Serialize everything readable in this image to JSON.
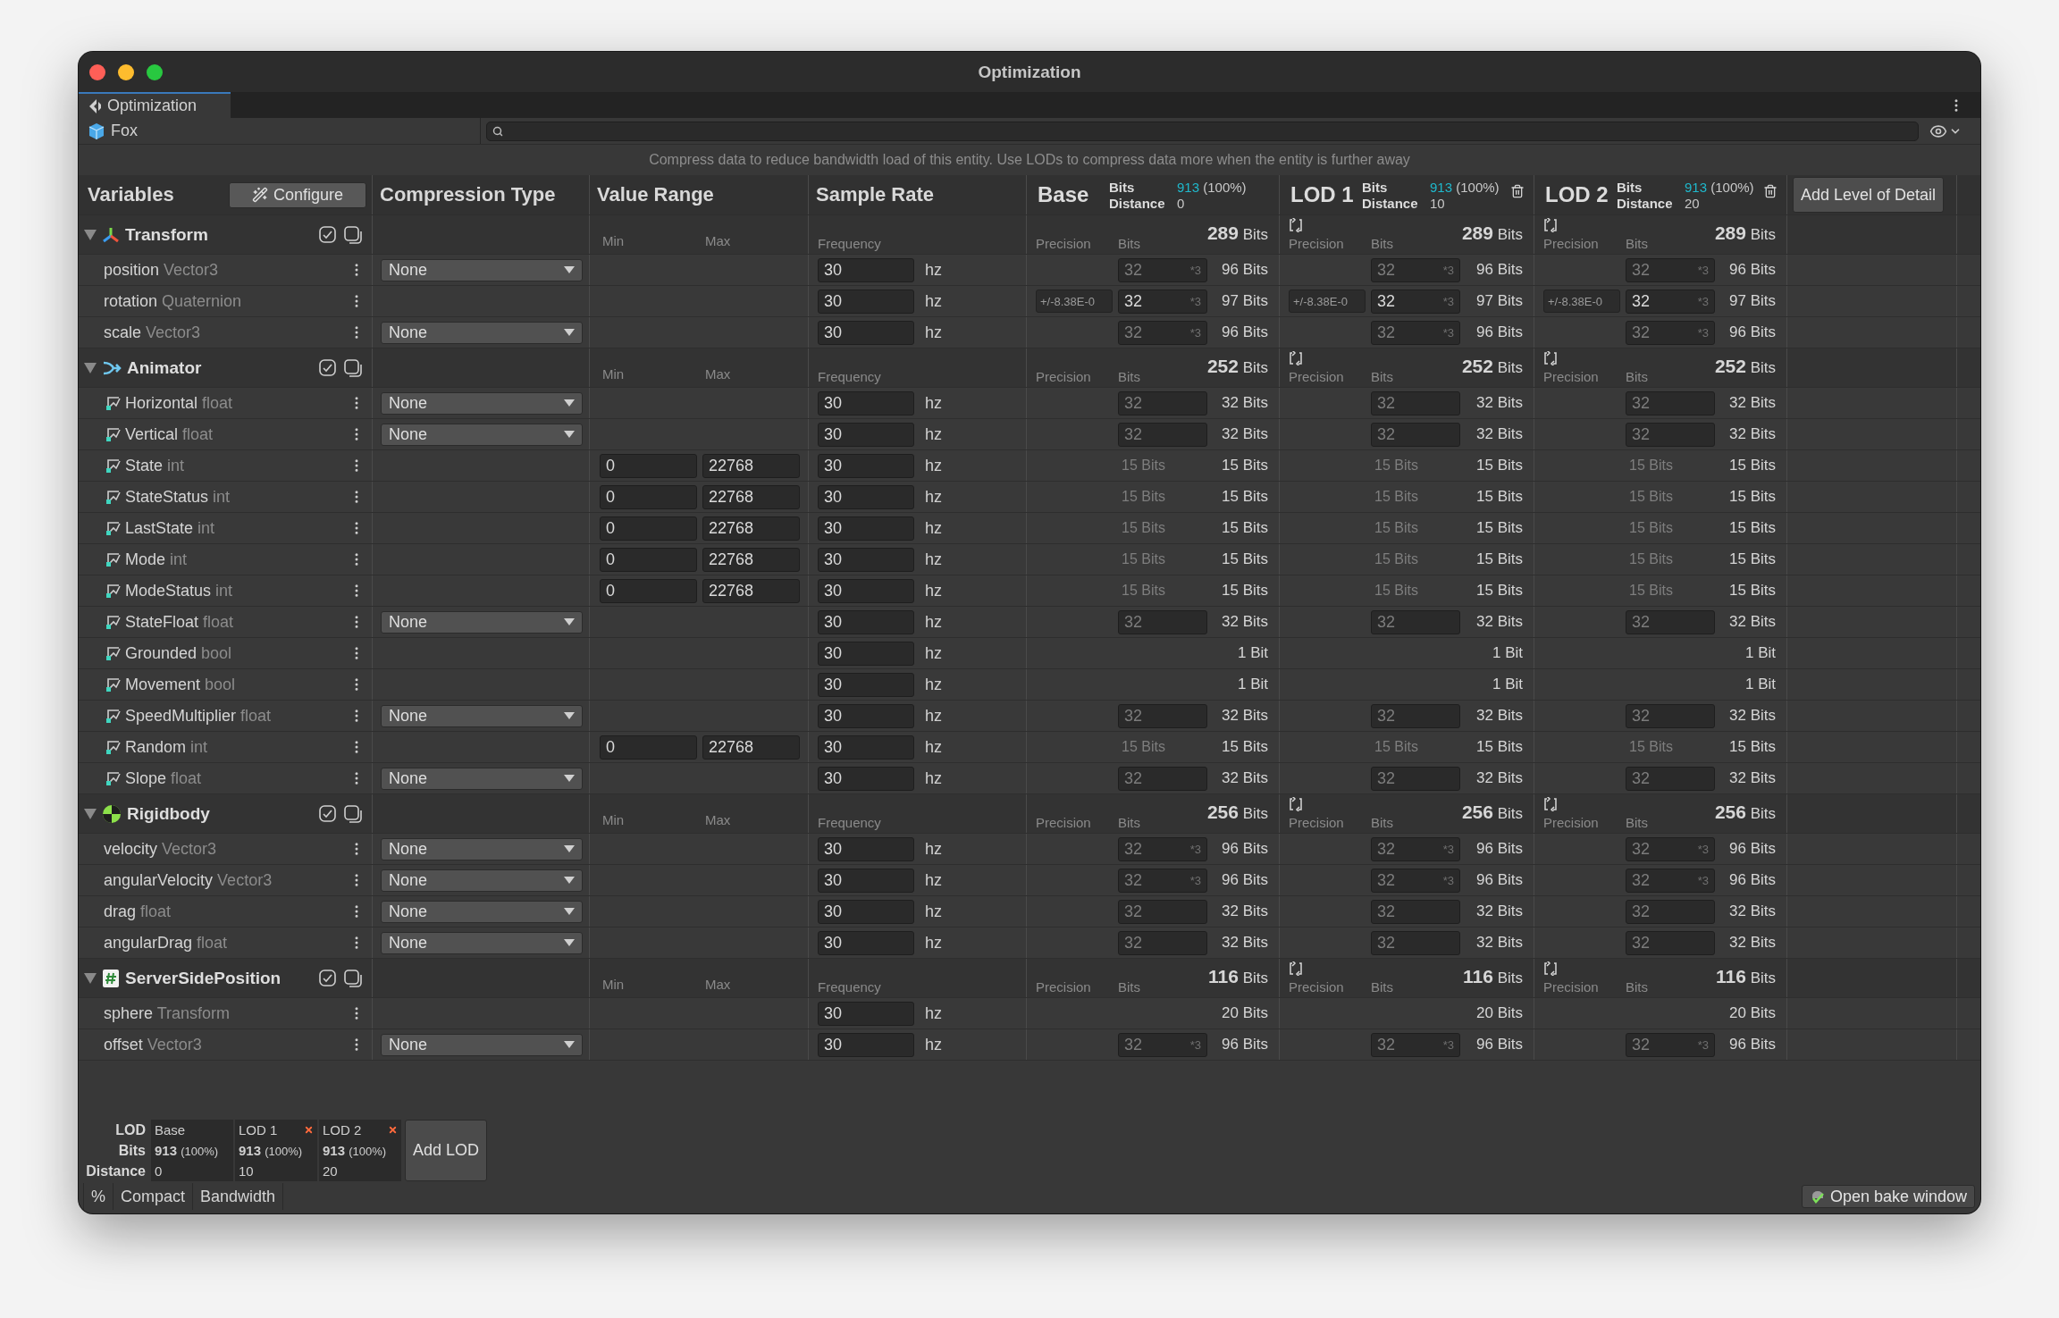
{
  "window": {
    "title": "Optimization"
  },
  "tabs": [
    {
      "label": "Optimization",
      "selected": true
    }
  ],
  "object": {
    "name": "Fox"
  },
  "hint": "Compress data to reduce bandwidth load of this entity. Use LODs to compress data more when the entity is further away",
  "columns": {
    "variables": "Variables",
    "configure": "Configure",
    "compression": "Compression Type",
    "range": "Value Range",
    "sample": "Sample Rate",
    "add_lod": "Add Level of Detail"
  },
  "lods": [
    {
      "title": "Base",
      "bits_label": "Bits",
      "bits": "913",
      "share": "(100%)",
      "distance_label": "Distance",
      "distance": "0",
      "removable": false
    },
    {
      "title": "LOD 1",
      "bits_label": "Bits",
      "bits": "913",
      "share": "(100%)",
      "distance_label": "Distance",
      "distance": "10",
      "removable": true
    },
    {
      "title": "LOD 2",
      "bits_label": "Bits",
      "bits": "913",
      "share": "(100%)",
      "distance_label": "Distance",
      "distance": "20",
      "removable": true
    }
  ],
  "groups": [
    {
      "name": "Transform",
      "kind": "transform",
      "expanded": true,
      "min_label": "Min",
      "max_label": "Max",
      "frequency_label": "Frequency",
      "lod_headers": [
        {
          "precision_label": "Precision",
          "bits_label": "Bits",
          "total": "**289** Bits",
          "reset": false
        },
        {
          "precision_label": "Precision",
          "bits_label": "Bits",
          "total": "**289** Bits",
          "reset": true
        },
        {
          "precision_label": "Precision",
          "bits_label": "Bits",
          "total": "**289** Bits",
          "reset": true
        }
      ],
      "rows": [
        {
          "name": "position",
          "type": "Vector3",
          "kind": "field",
          "compression": "None",
          "frequency": "30",
          "unit": "hz",
          "lods": [
            {
              "kind": "input",
              "value": "32",
              "multiplier": "*3",
              "disabled": true,
              "total": "96 Bits"
            },
            {
              "kind": "input",
              "value": "32",
              "multiplier": "*3",
              "disabled": true,
              "total": "96 Bits"
            },
            {
              "kind": "input",
              "value": "32",
              "multiplier": "*3",
              "disabled": true,
              "total": "96 Bits"
            }
          ]
        },
        {
          "name": "rotation",
          "type": "Quaternion",
          "kind": "field",
          "frequency": "30",
          "unit": "hz",
          "lods": [
            {
              "kind": "input",
              "precision": "+/-8.38E-0",
              "value": "32",
              "multiplier": "*3",
              "disabled": false,
              "total": "97 Bits"
            },
            {
              "kind": "input",
              "precision": "+/-8.38E-0",
              "value": "32",
              "multiplier": "*3",
              "disabled": false,
              "total": "97 Bits"
            },
            {
              "kind": "input",
              "precision": "+/-8.38E-0",
              "value": "32",
              "multiplier": "*3",
              "disabled": false,
              "total": "97 Bits"
            }
          ]
        },
        {
          "name": "scale",
          "type": "Vector3",
          "kind": "field",
          "compression": "None",
          "frequency": "30",
          "unit": "hz",
          "lods": [
            {
              "kind": "input",
              "value": "32",
              "multiplier": "*3",
              "disabled": true,
              "total": "96 Bits"
            },
            {
              "kind": "input",
              "value": "32",
              "multiplier": "*3",
              "disabled": true,
              "total": "96 Bits"
            },
            {
              "kind": "input",
              "value": "32",
              "multiplier": "*3",
              "disabled": true,
              "total": "96 Bits"
            }
          ]
        }
      ]
    },
    {
      "name": "Animator",
      "kind": "animator",
      "expanded": true,
      "min_label": "Min",
      "max_label": "Max",
      "frequency_label": "Frequency",
      "lod_headers": [
        {
          "precision_label": "Precision",
          "bits_label": "Bits",
          "total": "**252** Bits",
          "reset": false
        },
        {
          "precision_label": "Precision",
          "bits_label": "Bits",
          "total": "**252** Bits",
          "reset": true
        },
        {
          "precision_label": "Precision",
          "bits_label": "Bits",
          "total": "**252** Bits",
          "reset": true
        }
      ],
      "rows": [
        {
          "name": "Horizontal",
          "type": "float",
          "kind": "param",
          "compression": "None",
          "frequency": "30",
          "unit": "hz",
          "lods": [
            {
              "kind": "input",
              "value": "32",
              "disabled": true,
              "total": "32 Bits"
            },
            {
              "kind": "input",
              "value": "32",
              "disabled": true,
              "total": "32 Bits"
            },
            {
              "kind": "input",
              "value": "32",
              "disabled": true,
              "total": "32 Bits"
            }
          ]
        },
        {
          "name": "Vertical",
          "type": "float",
          "kind": "param",
          "compression": "None",
          "frequency": "30",
          "unit": "hz",
          "lods": [
            {
              "kind": "input",
              "value": "32",
              "disabled": true,
              "total": "32 Bits"
            },
            {
              "kind": "input",
              "value": "32",
              "disabled": true,
              "total": "32 Bits"
            },
            {
              "kind": "input",
              "value": "32",
              "disabled": true,
              "total": "32 Bits"
            }
          ]
        },
        {
          "name": "State",
          "type": "int",
          "kind": "param",
          "min": "0",
          "max": "22768",
          "frequency": "30",
          "unit": "hz",
          "lods": [
            {
              "kind": "computed",
              "computed": "15 Bits",
              "total": "15 Bits"
            },
            {
              "kind": "computed",
              "computed": "15 Bits",
              "total": "15 Bits"
            },
            {
              "kind": "computed",
              "computed": "15 Bits",
              "total": "15 Bits"
            }
          ]
        },
        {
          "name": "StateStatus",
          "type": "int",
          "kind": "param",
          "min": "0",
          "max": "22768",
          "frequency": "30",
          "unit": "hz",
          "lods": [
            {
              "kind": "computed",
              "computed": "15 Bits",
              "total": "15 Bits"
            },
            {
              "kind": "computed",
              "computed": "15 Bits",
              "total": "15 Bits"
            },
            {
              "kind": "computed",
              "computed": "15 Bits",
              "total": "15 Bits"
            }
          ]
        },
        {
          "name": "LastState",
          "type": "int",
          "kind": "param",
          "min": "0",
          "max": "22768",
          "frequency": "30",
          "unit": "hz",
          "lods": [
            {
              "kind": "computed",
              "computed": "15 Bits",
              "total": "15 Bits"
            },
            {
              "kind": "computed",
              "computed": "15 Bits",
              "total": "15 Bits"
            },
            {
              "kind": "computed",
              "computed": "15 Bits",
              "total": "15 Bits"
            }
          ]
        },
        {
          "name": "Mode",
          "type": "int",
          "kind": "param",
          "min": "0",
          "max": "22768",
          "frequency": "30",
          "unit": "hz",
          "lods": [
            {
              "kind": "computed",
              "computed": "15 Bits",
              "total": "15 Bits"
            },
            {
              "kind": "computed",
              "computed": "15 Bits",
              "total": "15 Bits"
            },
            {
              "kind": "computed",
              "computed": "15 Bits",
              "total": "15 Bits"
            }
          ]
        },
        {
          "name": "ModeStatus",
          "type": "int",
          "kind": "param",
          "min": "0",
          "max": "22768",
          "frequency": "30",
          "unit": "hz",
          "lods": [
            {
              "kind": "computed",
              "computed": "15 Bits",
              "total": "15 Bits"
            },
            {
              "kind": "computed",
              "computed": "15 Bits",
              "total": "15 Bits"
            },
            {
              "kind": "computed",
              "computed": "15 Bits",
              "total": "15 Bits"
            }
          ]
        },
        {
          "name": "StateFloat",
          "type": "float",
          "kind": "param",
          "compression": "None",
          "frequency": "30",
          "unit": "hz",
          "lods": [
            {
              "kind": "input",
              "value": "32",
              "disabled": true,
              "total": "32 Bits"
            },
            {
              "kind": "input",
              "value": "32",
              "disabled": true,
              "total": "32 Bits"
            },
            {
              "kind": "input",
              "value": "32",
              "disabled": true,
              "total": "32 Bits"
            }
          ]
        },
        {
          "name": "Grounded",
          "type": "bool",
          "kind": "param",
          "frequency": "30",
          "unit": "hz",
          "lods": [
            {
              "kind": "total",
              "total": "1 Bit"
            },
            {
              "kind": "total",
              "total": "1 Bit"
            },
            {
              "kind": "total",
              "total": "1 Bit"
            }
          ]
        },
        {
          "name": "Movement",
          "type": "bool",
          "kind": "param",
          "frequency": "30",
          "unit": "hz",
          "lods": [
            {
              "kind": "total",
              "total": "1 Bit"
            },
            {
              "kind": "total",
              "total": "1 Bit"
            },
            {
              "kind": "total",
              "total": "1 Bit"
            }
          ]
        },
        {
          "name": "SpeedMultiplier",
          "type": "float",
          "kind": "param",
          "compression": "None",
          "frequency": "30",
          "unit": "hz",
          "lods": [
            {
              "kind": "input",
              "value": "32",
              "disabled": true,
              "total": "32 Bits"
            },
            {
              "kind": "input",
              "value": "32",
              "disabled": true,
              "total": "32 Bits"
            },
            {
              "kind": "input",
              "value": "32",
              "disabled": true,
              "total": "32 Bits"
            }
          ]
        },
        {
          "name": "Random",
          "type": "int",
          "kind": "param",
          "min": "0",
          "max": "22768",
          "frequency": "30",
          "unit": "hz",
          "lods": [
            {
              "kind": "computed",
              "computed": "15 Bits",
              "total": "15 Bits"
            },
            {
              "kind": "computed",
              "computed": "15 Bits",
              "total": "15 Bits"
            },
            {
              "kind": "computed",
              "computed": "15 Bits",
              "total": "15 Bits"
            }
          ]
        },
        {
          "name": "Slope",
          "type": "float",
          "kind": "param",
          "compression": "None",
          "frequency": "30",
          "unit": "hz",
          "lods": [
            {
              "kind": "input",
              "value": "32",
              "disabled": true,
              "total": "32 Bits"
            },
            {
              "kind": "input",
              "value": "32",
              "disabled": true,
              "total": "32 Bits"
            },
            {
              "kind": "input",
              "value": "32",
              "disabled": true,
              "total": "32 Bits"
            }
          ]
        }
      ]
    },
    {
      "name": "Rigidbody",
      "kind": "rigidbody",
      "expanded": true,
      "min_label": "Min",
      "max_label": "Max",
      "frequency_label": "Frequency",
      "lod_headers": [
        {
          "precision_label": "Precision",
          "bits_label": "Bits",
          "total": "**256** Bits",
          "reset": false
        },
        {
          "precision_label": "Precision",
          "bits_label": "Bits",
          "total": "**256** Bits",
          "reset": true
        },
        {
          "precision_label": "Precision",
          "bits_label": "Bits",
          "total": "**256** Bits",
          "reset": true
        }
      ],
      "rows": [
        {
          "name": "velocity",
          "type": "Vector3",
          "kind": "field",
          "compression": "None",
          "frequency": "30",
          "unit": "hz",
          "lods": [
            {
              "kind": "input",
              "value": "32",
              "multiplier": "*3",
              "disabled": true,
              "total": "96 Bits"
            },
            {
              "kind": "input",
              "value": "32",
              "multiplier": "*3",
              "disabled": true,
              "total": "96 Bits"
            },
            {
              "kind": "input",
              "value": "32",
              "multiplier": "*3",
              "disabled": true,
              "total": "96 Bits"
            }
          ]
        },
        {
          "name": "angularVelocity",
          "type": "Vector3",
          "kind": "field",
          "compression": "None",
          "frequency": "30",
          "unit": "hz",
          "lods": [
            {
              "kind": "input",
              "value": "32",
              "multiplier": "*3",
              "disabled": true,
              "total": "96 Bits"
            },
            {
              "kind": "input",
              "value": "32",
              "multiplier": "*3",
              "disabled": true,
              "total": "96 Bits"
            },
            {
              "kind": "input",
              "value": "32",
              "multiplier": "*3",
              "disabled": true,
              "total": "96 Bits"
            }
          ]
        },
        {
          "name": "drag",
          "type": "float",
          "kind": "field",
          "compression": "None",
          "frequency": "30",
          "unit": "hz",
          "lods": [
            {
              "kind": "input",
              "value": "32",
              "disabled": true,
              "total": "32 Bits"
            },
            {
              "kind": "input",
              "value": "32",
              "disabled": true,
              "total": "32 Bits"
            },
            {
              "kind": "input",
              "value": "32",
              "disabled": true,
              "total": "32 Bits"
            }
          ]
        },
        {
          "name": "angularDrag",
          "type": "float",
          "kind": "field",
          "compression": "None",
          "frequency": "30",
          "unit": "hz",
          "lods": [
            {
              "kind": "input",
              "value": "32",
              "disabled": true,
              "total": "32 Bits"
            },
            {
              "kind": "input",
              "value": "32",
              "disabled": true,
              "total": "32 Bits"
            },
            {
              "kind": "input",
              "value": "32",
              "disabled": true,
              "total": "32 Bits"
            }
          ]
        }
      ]
    },
    {
      "name": "ServerSidePosition",
      "kind": "script",
      "expanded": true,
      "min_label": "Min",
      "max_label": "Max",
      "frequency_label": "Frequency",
      "lod_headers": [
        {
          "precision_label": "Precision",
          "bits_label": "Bits",
          "total": "**116** Bits",
          "reset": false
        },
        {
          "precision_label": "Precision",
          "bits_label": "Bits",
          "total": "**116** Bits",
          "reset": true
        },
        {
          "precision_label": "Precision",
          "bits_label": "Bits",
          "total": "**116** Bits",
          "reset": true
        }
      ],
      "rows": [
        {
          "name": "sphere",
          "type": "Transform",
          "kind": "field",
          "frequency": "30",
          "unit": "hz",
          "lods": [
            {
              "kind": "total",
              "total": "20 Bits"
            },
            {
              "kind": "total",
              "total": "20 Bits"
            },
            {
              "kind": "total",
              "total": "20 Bits"
            }
          ]
        },
        {
          "name": "offset",
          "type": "Vector3",
          "kind": "field",
          "compression": "None",
          "frequency": "30",
          "unit": "hz",
          "lods": [
            {
              "kind": "input",
              "value": "32",
              "multiplier": "*3",
              "disabled": true,
              "total": "96 Bits"
            },
            {
              "kind": "input",
              "value": "32",
              "multiplier": "*3",
              "disabled": true,
              "total": "96 Bits"
            },
            {
              "kind": "input",
              "value": "32",
              "multiplier": "*3",
              "disabled": true,
              "total": "96 Bits"
            }
          ]
        }
      ]
    }
  ],
  "lod_summary": {
    "labels": [
      "LOD",
      "Bits",
      "Distance"
    ],
    "cells": [
      {
        "name": "Base",
        "bits": "913",
        "share": "(100%)",
        "distance": "0",
        "removable": false
      },
      {
        "name": "LOD 1",
        "bits": "913",
        "share": "(100%)",
        "distance": "10",
        "removable": true
      },
      {
        "name": "LOD 2",
        "bits": "913",
        "share": "(100%)",
        "distance": "20",
        "removable": true
      }
    ],
    "add": "Add LOD"
  },
  "view_tabs": [
    {
      "label": "%",
      "selected": false
    },
    {
      "label": "Compact",
      "selected": false
    },
    {
      "label": "Bandwidth",
      "selected": false
    }
  ],
  "bake_button": "Open bake window"
}
